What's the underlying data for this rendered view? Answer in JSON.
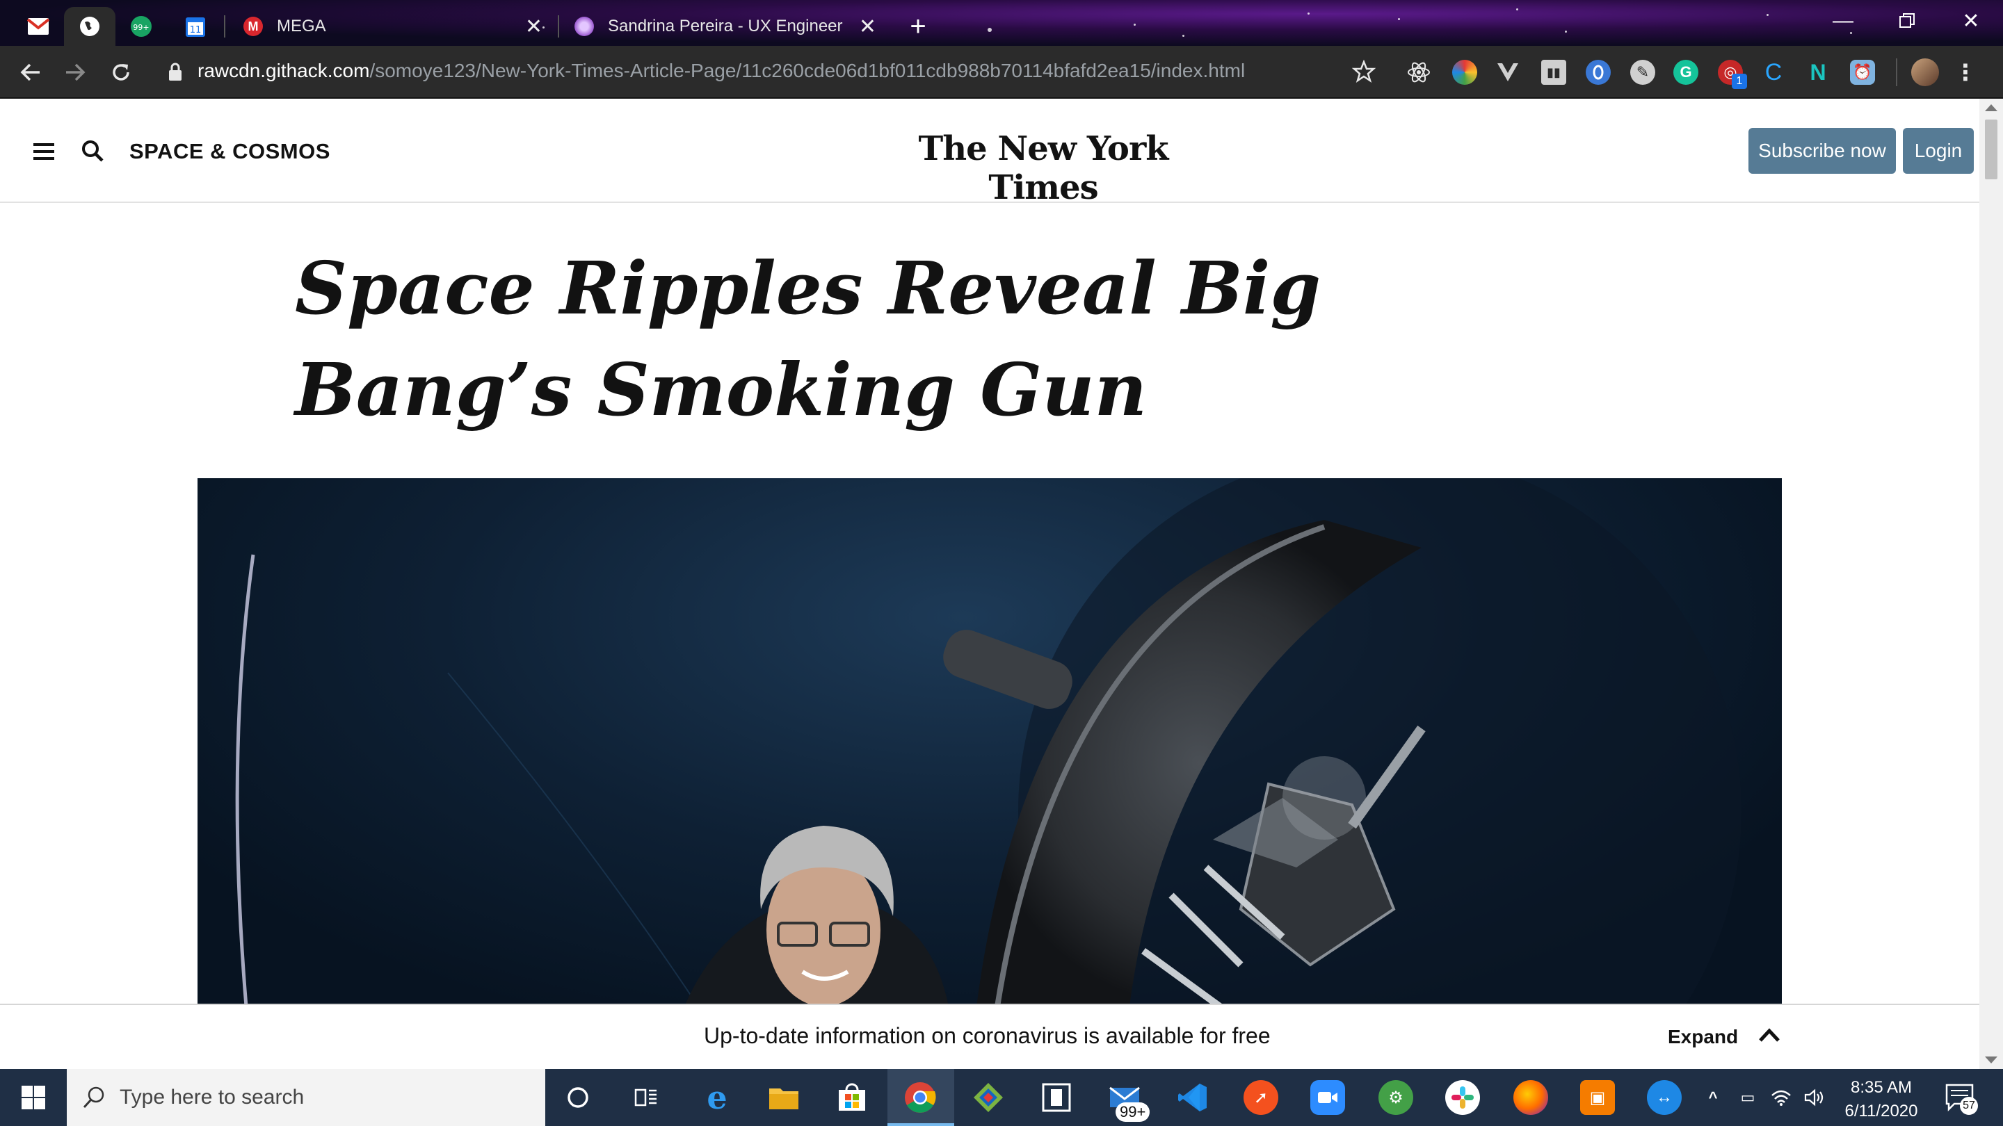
{
  "browser": {
    "tabs": [
      {
        "title": "MEGA",
        "active": false
      },
      {
        "title": "Sandrina Pereira - UX Engineer",
        "active": false
      }
    ],
    "address": {
      "host": "rawcdn.githack.com",
      "path": "/somoye123/New-York-Times-Article-Page/11c260cde06d1bf011cdb988b70114bfafd2ea15/index.html"
    },
    "extension_badge": "1"
  },
  "nyt": {
    "section": "SPACE & COSMOS",
    "logo": "The New York Times",
    "subscribe_label": "Subscribe now",
    "login_label": "Login",
    "headline": "Space Ripples Reveal Big Bang’s Smoking Gun",
    "covid_banner": "Up-to-date information on coronavirus is available for free",
    "expand_label": "Expand"
  },
  "taskbar": {
    "search_placeholder": "Type here to search",
    "mail_badge": "99+",
    "time": "8:35 AM",
    "date": "6/11/2020",
    "notification_count": "57"
  },
  "colors": {
    "button_blue": "#567b95",
    "taskbar": "#1f2f45",
    "toolbar": "#2b2b2b"
  }
}
